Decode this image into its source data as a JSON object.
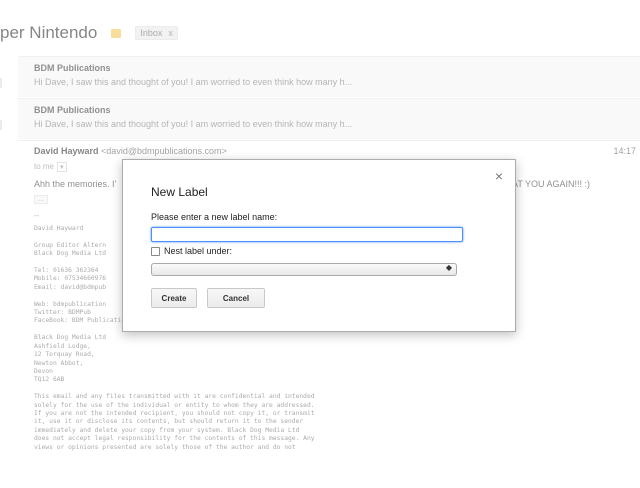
{
  "thread": {
    "subject": "per Nintendo",
    "label_chip": "Inbox",
    "label_chip_close": "x"
  },
  "messages_collapsed": [
    {
      "sender": "BDM Publications",
      "snippet": "Hi Dave, I saw this and thought of you! I am worried to even think how many h..."
    },
    {
      "sender": "BDM Publications",
      "snippet": "Hi Dave, I saw this and thought of you! I am worried to even think how many h..."
    }
  ],
  "message_expanded": {
    "sender_name": "David Hayward",
    "sender_email": "<david@bdmpublications.com>",
    "time": "14:17",
    "to": "to me",
    "body_start": "Ahh the memories. I'",
    "body_end": "AT YOU AGAIN!!! :)",
    "ellipsis": "...",
    "divider": "--",
    "signature_lines": [
      "David Hayward",
      "",
      "Group Editor Altern",
      "Black Dog Media Ltd",
      "",
      "Tel: 01636 362364",
      "Mobile: 07534660976",
      "Email: david@bdmpub",
      "",
      "Web: bdmpublication",
      "Twitter: BDMPub",
      "FaceBook: BDM Publications",
      "",
      "Black Dog Media Ltd",
      "Ashfield Lodge,",
      "12 Torquay Road,",
      "Newton Abbot,",
      "Devon",
      "TQ12 6AB",
      "",
      "This email and any files transmitted with it are confidential and intended",
      "solely for the use of the individual or entity to whom they are addressed.",
      "If you are not the intended recipient, you should not copy it, or transmit",
      "it, use it or disclose its contents, but should return it to the sender",
      "immediately and delete your copy from your system. Black Dog Media Ltd",
      "does not accept legal responsibility for the contents of this message. Any",
      "views or opinions presented are solely those of the author and do not"
    ]
  },
  "dialog": {
    "title": "New Label",
    "prompt": "Please enter a new label name:",
    "input_value": "",
    "nest_label": "Nest label under:",
    "select_value": "",
    "create_label": "Create",
    "cancel_label": "Cancel",
    "close_glyph": "×"
  },
  "colors": {
    "focus_border": "#4d90fe",
    "link": "#3366cc",
    "tag": "#f0c34a"
  }
}
